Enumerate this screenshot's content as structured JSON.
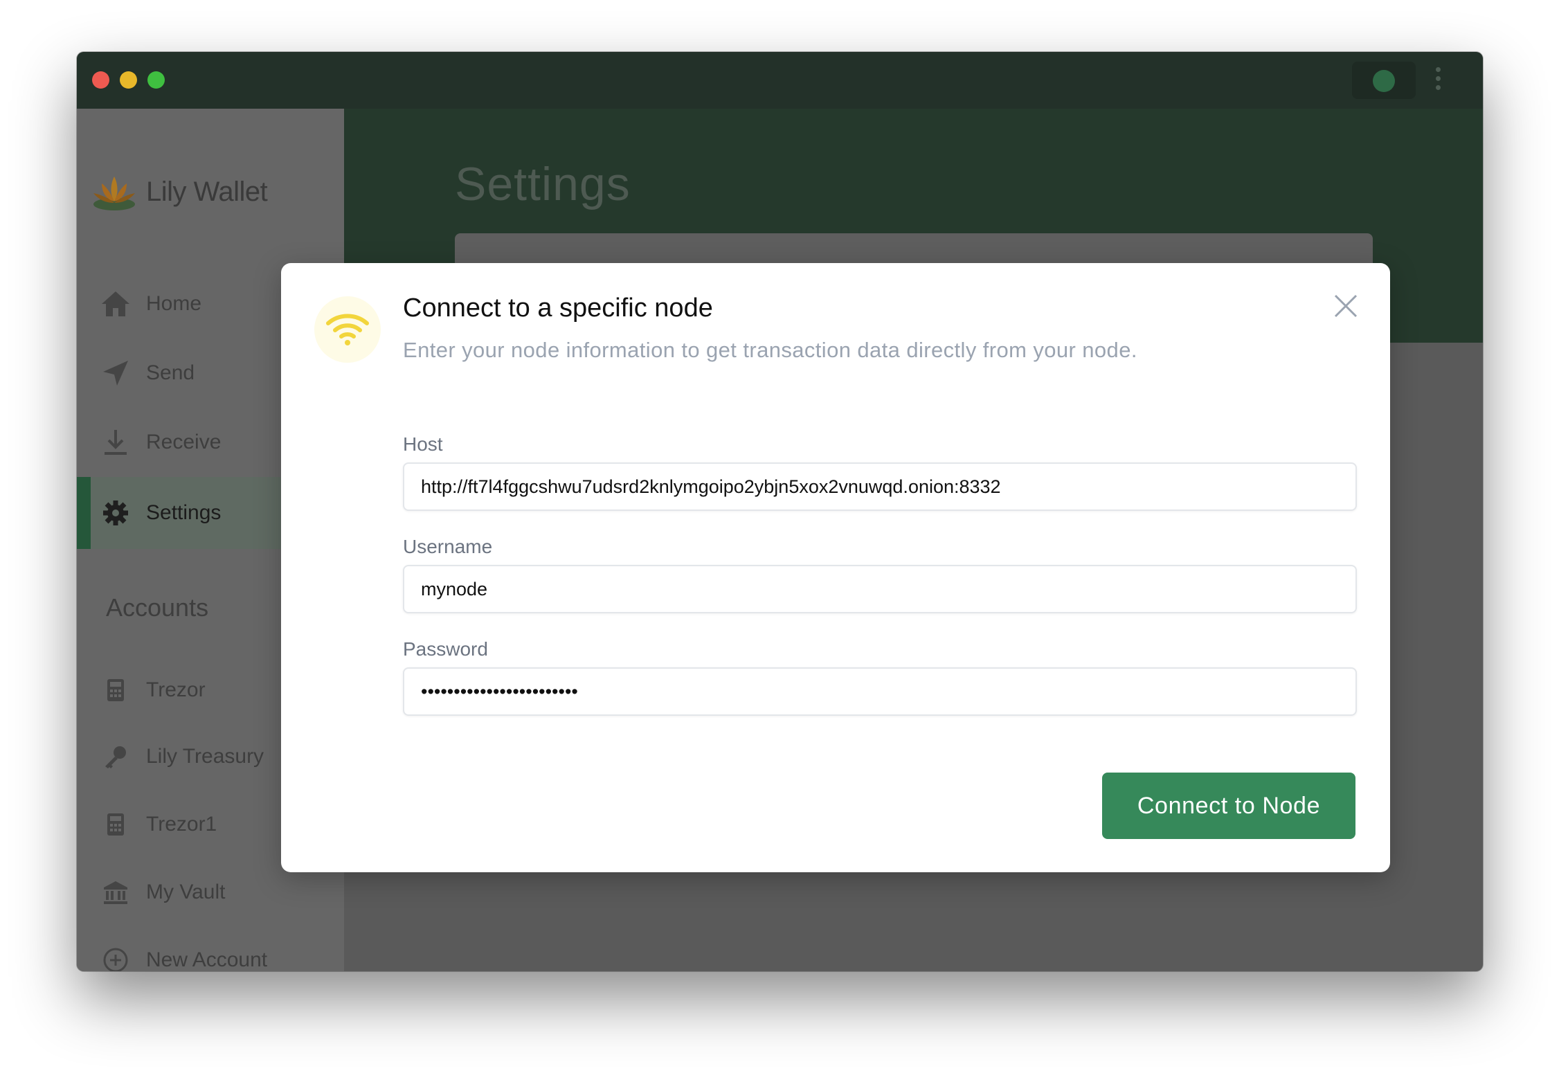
{
  "app": {
    "name": "Lily Wallet"
  },
  "sidebar": {
    "items": [
      {
        "label": "Home",
        "icon": "home-icon"
      },
      {
        "label": "Send",
        "icon": "send-icon"
      },
      {
        "label": "Receive",
        "icon": "download-icon"
      },
      {
        "label": "Settings",
        "icon": "gear-icon",
        "active": true
      }
    ],
    "accounts_heading": "Accounts",
    "accounts": [
      {
        "label": "Trezor",
        "icon": "calculator-icon"
      },
      {
        "label": "Lily Treasury",
        "icon": "key-icon"
      },
      {
        "label": "Trezor1",
        "icon": "calculator-icon"
      },
      {
        "label": "My Vault",
        "icon": "bank-icon"
      },
      {
        "label": "New Account",
        "icon": "plus-circle-icon"
      }
    ]
  },
  "main": {
    "title": "Settings"
  },
  "modal": {
    "title": "Connect to a specific node",
    "subtitle": "Enter your node information to get transaction data directly from your node.",
    "host_label": "Host",
    "host_value": "http://ft7l4fggcshwu7udsrd2knlymgoipo2ybjn5xox2vnuwqd.onion:8332",
    "username_label": "Username",
    "username_value": "mynode",
    "password_label": "Password",
    "password_value": "••••••••••••••••••••••••",
    "connect_label": "Connect to Node"
  },
  "colors": {
    "accent": "#36895a",
    "titlebar": "#233129",
    "header": "#25392c",
    "wifi_icon": "#f2d53c"
  }
}
